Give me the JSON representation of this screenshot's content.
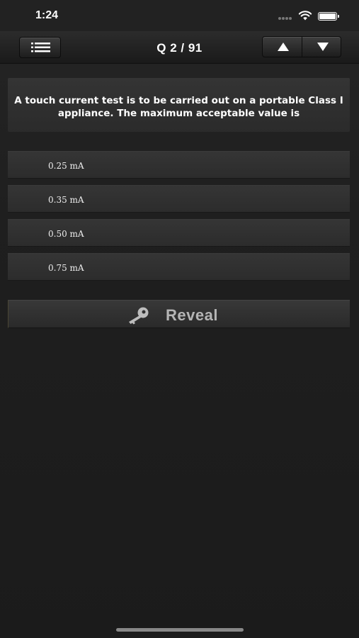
{
  "status_bar": {
    "time": "1:24",
    "icons": [
      "signal-dots-icon",
      "wifi-icon",
      "battery-icon"
    ]
  },
  "nav": {
    "title": "Q 2 / 91",
    "menu_icon": "list-icon",
    "prev_icon": "triangle-up-icon",
    "next_icon": "triangle-down-icon"
  },
  "question": {
    "line1": "A touch current test is to be carried out on a portable Class I",
    "line2": "appliance. The maximum acceptable value is"
  },
  "answers": [
    {
      "label": "0.25 mA"
    },
    {
      "label": "0.35 mA"
    },
    {
      "label": "0.50 mA"
    },
    {
      "label": "0.75 mA"
    }
  ],
  "reveal": {
    "label": "Reveal",
    "icon": "key-icon"
  },
  "colors": {
    "background": "#1e1e1e",
    "panel": "#2f2f2f",
    "reveal_text": "#b5b5b5"
  }
}
